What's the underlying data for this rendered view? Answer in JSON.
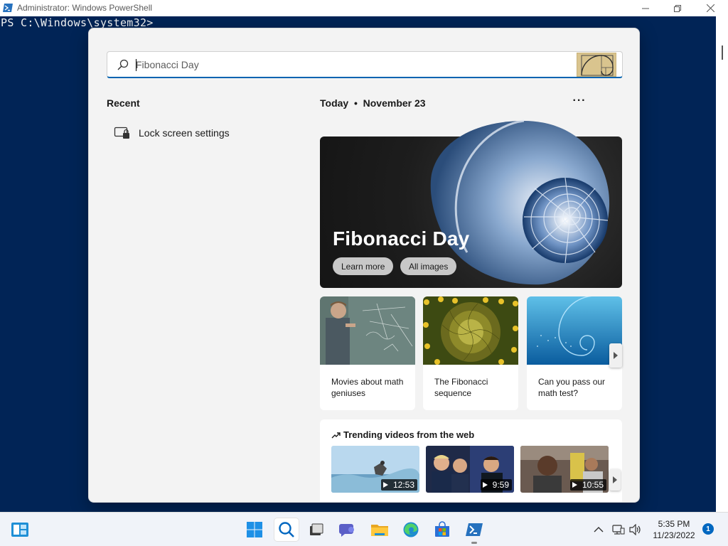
{
  "window": {
    "title": "Administrator: Windows PowerShell",
    "prompt": "PS C:\\Windows\\system32>"
  },
  "search": {
    "value": "",
    "placeholder": "Fibonacci Day",
    "highlight_icon": "golden-spiral-icon"
  },
  "recent": {
    "heading": "Recent",
    "items": [
      {
        "label": "Lock screen settings",
        "icon": "lock-screen-settings-icon"
      }
    ]
  },
  "today": {
    "heading": "Today  •  November 23",
    "more_label": "···"
  },
  "hero": {
    "title": "Fibonacci Day",
    "buttons": [
      "Learn more",
      "All images"
    ]
  },
  "tiles": [
    {
      "label": "Movies about math geniuses"
    },
    {
      "label": "The Fibonacci sequence"
    },
    {
      "label": "Can you pass our math test?"
    }
  ],
  "trending": {
    "heading": "Trending videos from the web",
    "videos": [
      {
        "duration": "12:53"
      },
      {
        "duration": "9:59"
      },
      {
        "duration": "10:55"
      }
    ]
  },
  "taskbar": {
    "time": "5:35 PM",
    "date": "11/23/2022",
    "notification_count": "1",
    "pinned": [
      "start",
      "search",
      "task-view",
      "chat",
      "file-explorer",
      "edge",
      "store",
      "powershell"
    ]
  },
  "colors": {
    "console_bg": "#012456",
    "accent": "#0063b1",
    "panel_bg": "#f3f3f3"
  }
}
